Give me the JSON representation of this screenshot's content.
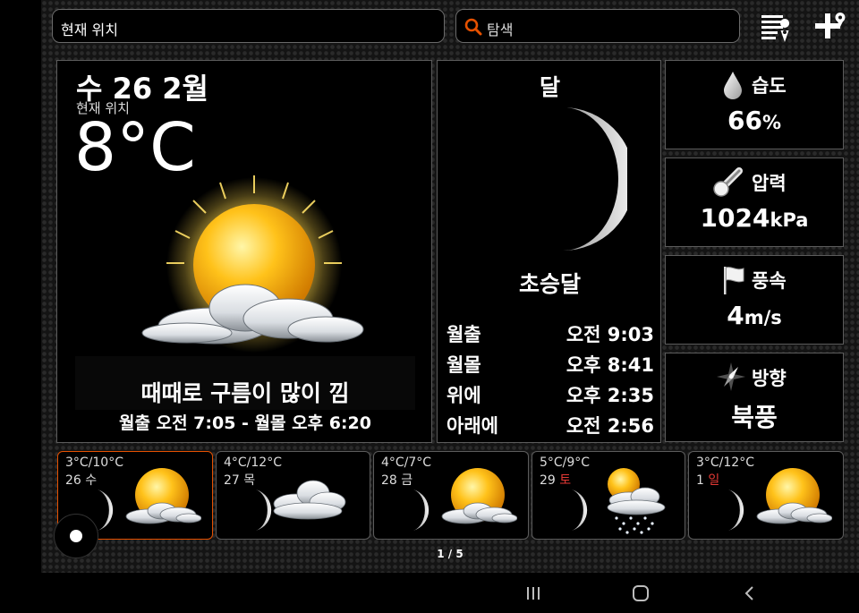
{
  "header": {
    "location_field": "현재 위치",
    "search_placeholder": "탐색"
  },
  "current": {
    "date": "수 26 2월",
    "location": "현재 위치",
    "temperature": "8°C",
    "condition": "때때로 구름이 많이 낌",
    "sun_times": "월출 오전 7:05 - 월몰 오후 6:20"
  },
  "moon": {
    "title": "달",
    "phase": "초승달",
    "rows": [
      {
        "label": "월출",
        "value": "오전 9:03"
      },
      {
        "label": "월몰",
        "value": "오후 8:41"
      },
      {
        "label": "위에",
        "value": "오후 2:35"
      },
      {
        "label": "아래에",
        "value": "오전 2:56"
      }
    ]
  },
  "stats": {
    "humidity": {
      "label": "습도",
      "value": "66",
      "unit": "%"
    },
    "pressure": {
      "label": "압력",
      "value": "1024",
      "unit": "kPa"
    },
    "wind_speed": {
      "label": "풍속",
      "value": "4",
      "unit": "m/s"
    },
    "direction": {
      "label": "방향",
      "value": "북풍"
    }
  },
  "forecast": [
    {
      "range": "3°C/10°C",
      "date": "26",
      "weekday": "수",
      "weekend": false,
      "icon": "sun-cloud-icon",
      "selected": true
    },
    {
      "range": "4°C/12°C",
      "date": "27",
      "weekday": "목",
      "weekend": false,
      "icon": "cloud-icon",
      "selected": false
    },
    {
      "range": "4°C/7°C",
      "date": "28",
      "weekday": "금",
      "weekend": false,
      "icon": "sun-cloud-icon",
      "selected": false
    },
    {
      "range": "5°C/9°C",
      "date": "29",
      "weekday": "토",
      "weekend": true,
      "icon": "snow-cloud-icon",
      "selected": false
    },
    {
      "range": "3°C/12°C",
      "date": "1",
      "weekday": "일",
      "weekend": true,
      "icon": "sun-cloud-icon",
      "selected": false
    }
  ],
  "pager": "1 / 5",
  "colors": {
    "accent": "#e65100",
    "panel_border": "#5c5c5c",
    "weekend": "#e53935"
  }
}
